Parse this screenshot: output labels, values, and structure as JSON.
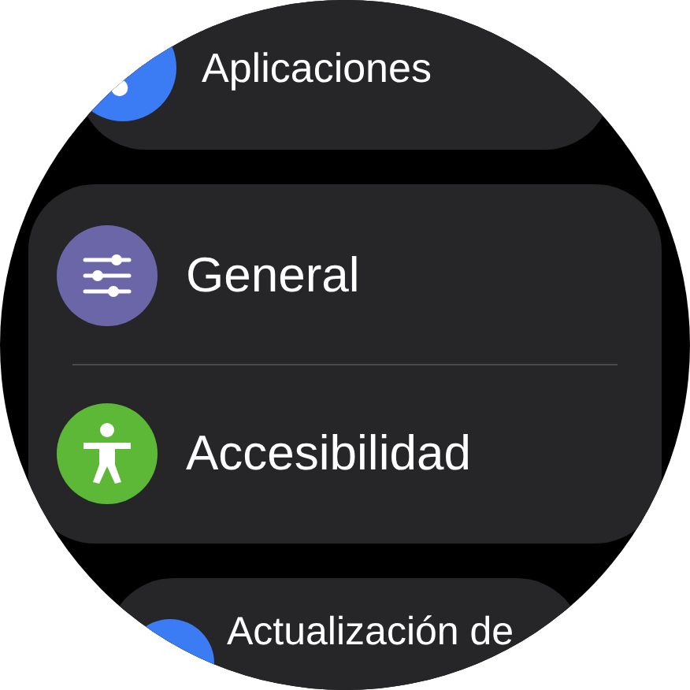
{
  "sections": [
    {
      "items": [
        {
          "label": "Aplicaciones",
          "kind": "apps",
          "color": "#3b7cf4"
        }
      ]
    },
    {
      "items": [
        {
          "label": "General",
          "kind": "sliders",
          "color": "#6b66a8"
        },
        {
          "label": "Accesibilidad",
          "kind": "accessibility",
          "color": "#5db838"
        }
      ]
    },
    {
      "items": [
        {
          "label": "Actualización de",
          "kind": "plain",
          "color": "#3b7cf4"
        }
      ]
    }
  ]
}
